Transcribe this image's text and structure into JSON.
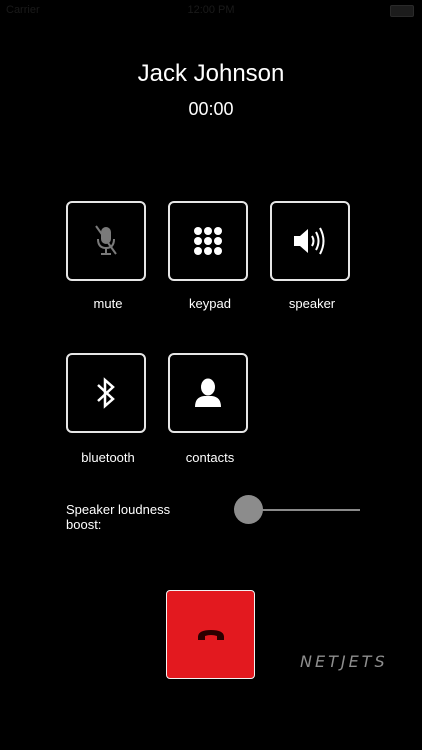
{
  "status_bar": {
    "carrier": "Carrier",
    "time": "12:00 PM"
  },
  "call": {
    "caller_name": "Jack Johnson",
    "duration": "00:00"
  },
  "controls": [
    {
      "id": "mute",
      "label": "mute",
      "icon": "muted-microphone-icon",
      "enabled": false
    },
    {
      "id": "keypad",
      "label": "keypad",
      "icon": "keypad-grid-icon",
      "enabled": true
    },
    {
      "id": "speaker",
      "label": "speaker",
      "icon": "speaker-volume-icon",
      "enabled": true
    },
    {
      "id": "bluetooth",
      "label": "bluetooth",
      "icon": "bluetooth-icon",
      "enabled": true
    },
    {
      "id": "contacts",
      "label": "contacts",
      "icon": "contact-person-icon",
      "enabled": true
    }
  ],
  "boost": {
    "label": "Speaker loudness boost:",
    "level": 0
  },
  "hangup": {
    "icon": "hang-up-phone-icon",
    "color": "#e3191f"
  },
  "brand": {
    "logo_text": "NETJETS"
  },
  "colors": {
    "background": "#000000",
    "text": "#ffffff",
    "button_border": "#e6e6e6",
    "disabled_icon": "#7a7a7a",
    "slider": "#8c8c8c"
  }
}
